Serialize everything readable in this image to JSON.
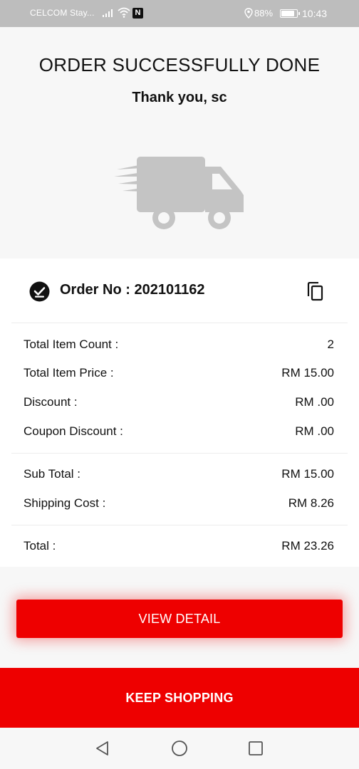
{
  "status_bar": {
    "carrier": "CELCOM Stay...",
    "nfc": "N",
    "battery_percent": "88%",
    "battery_level": 0.88,
    "time": "10:43"
  },
  "hero": {
    "title": "ORDER SUCCESSFULLY DONE",
    "thanks": "Thank you, sc",
    "illustration_icon": "delivery-truck-icon"
  },
  "order": {
    "label": "Order No : 202101162",
    "status_icon": "check-circle-icon",
    "copy_icon": "copy-icon"
  },
  "summary": {
    "total_item_count": {
      "label": "Total Item Count :",
      "value": "2"
    },
    "total_item_price": {
      "label": "Total Item Price :",
      "value": "RM 15.00"
    },
    "discount": {
      "label": "Discount :",
      "value": "RM .00"
    },
    "coupon_discount": {
      "label": "Coupon Discount :",
      "value": "RM .00"
    },
    "sub_total": {
      "label": "Sub Total :",
      "value": "RM 15.00"
    },
    "shipping_cost": {
      "label": "Shipping Cost :",
      "value": "RM 8.26"
    },
    "total": {
      "label": "Total :",
      "value": "RM 23.26"
    }
  },
  "buttons": {
    "view_detail": "VIEW DETAIL",
    "keep_shopping": "KEEP SHOPPING"
  },
  "colors": {
    "accent": "#ee0000",
    "status_bar_bg": "#bdbdbd",
    "page_bg": "#f7f7f7",
    "illustration": "#c4c4c4"
  }
}
